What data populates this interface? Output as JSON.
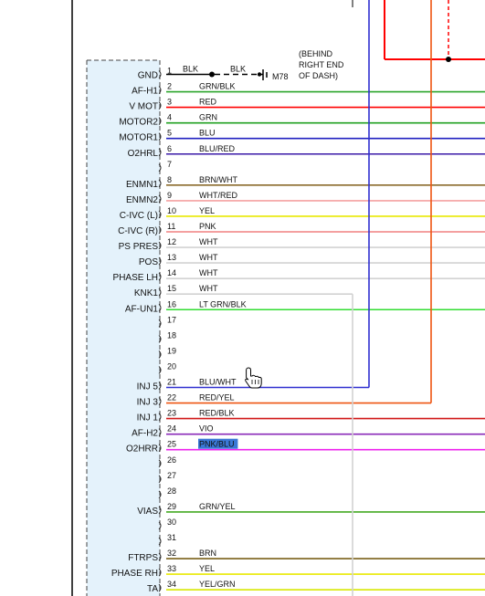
{
  "connector": {
    "pins": [
      {
        "num": "1",
        "name": "GND",
        "wire": "BLK",
        "color": "#000000"
      },
      {
        "num": "2",
        "name": "AF-H1",
        "wire": "GRN/BLK",
        "color": "#2aa52a"
      },
      {
        "num": "3",
        "name": "V MOT",
        "wire": "RED",
        "color": "#ff0000"
      },
      {
        "num": "4",
        "name": "MOTOR2",
        "wire": "GRN",
        "color": "#20a020"
      },
      {
        "num": "5",
        "name": "MOTOR1",
        "wire": "BLU",
        "color": "#2020c0"
      },
      {
        "num": "6",
        "name": "O2HRL",
        "wire": "BLU/RED",
        "color": "#3a1aa8"
      },
      {
        "num": "7",
        "name": "",
        "wire": "",
        "color": ""
      },
      {
        "num": "8",
        "name": "ENMN1",
        "wire": "BRN/WHT",
        "color": "#8a6a2a"
      },
      {
        "num": "9",
        "name": "ENMN2",
        "wire": "WHT/RED",
        "color": "#f4a0a0"
      },
      {
        "num": "10",
        "name": "C-IVC (L)",
        "wire": "YEL",
        "color": "#e8e800"
      },
      {
        "num": "11",
        "name": "C-IVC (R)",
        "wire": "PNK",
        "color": "#f08080"
      },
      {
        "num": "12",
        "name": "PS PRES",
        "wire": "WHT",
        "color": "#d2d2d2"
      },
      {
        "num": "13",
        "name": "POS",
        "wire": "WHT",
        "color": "#d2d2d2"
      },
      {
        "num": "14",
        "name": "PHASE LH",
        "wire": "WHT",
        "color": "#d2d2d2"
      },
      {
        "num": "15",
        "name": "KNK1",
        "wire": "WHT",
        "color": "#d2d2d2"
      },
      {
        "num": "16",
        "name": "AF-UN1",
        "wire": "LT GRN/BLK",
        "color": "#33dd33"
      },
      {
        "num": "17",
        "name": "",
        "wire": "",
        "color": ""
      },
      {
        "num": "18",
        "name": "",
        "wire": "",
        "color": ""
      },
      {
        "num": "19",
        "name": "",
        "wire": "",
        "color": ""
      },
      {
        "num": "20",
        "name": "",
        "wire": "",
        "color": ""
      },
      {
        "num": "21",
        "name": "INJ 5",
        "wire": "BLU/WHT",
        "color": "#3030d0"
      },
      {
        "num": "22",
        "name": "INJ 3",
        "wire": "RED/YEL",
        "color": "#ee5511"
      },
      {
        "num": "23",
        "name": "INJ 1",
        "wire": "RED/BLK",
        "color": "#d01818"
      },
      {
        "num": "24",
        "name": "AF-H2",
        "wire": "VIO",
        "color": "#8a2ab8"
      },
      {
        "num": "25",
        "name": "O2HRR",
        "wire": "PNK/BLU",
        "color": "#ee22ee"
      },
      {
        "num": "26",
        "name": "",
        "wire": "",
        "color": ""
      },
      {
        "num": "27",
        "name": "",
        "wire": "",
        "color": ""
      },
      {
        "num": "28",
        "name": "",
        "wire": "",
        "color": ""
      },
      {
        "num": "29",
        "name": "VIAS",
        "wire": "GRN/YEL",
        "color": "#44aa22"
      },
      {
        "num": "30",
        "name": "",
        "wire": "",
        "color": ""
      },
      {
        "num": "31",
        "name": "",
        "wire": "",
        "color": ""
      },
      {
        "num": "32",
        "name": "FTRPS",
        "wire": "BRN",
        "color": "#7a6018"
      },
      {
        "num": "33",
        "name": "PHASE RH",
        "wire": "YEL",
        "color": "#e8e800"
      },
      {
        "num": "34",
        "name": "TA",
        "wire": "YEL/GRN",
        "color": "#d8e800"
      }
    ]
  },
  "ground": {
    "wire_label": "BLK",
    "ref": "M78",
    "note_lines": [
      "(BEHIND",
      "RIGHT END",
      "OF DASH)"
    ]
  },
  "highlight": {
    "pin": "25"
  },
  "icons": {
    "cursor": "hand-pointer-icon",
    "ground": "ground-symbol-icon"
  }
}
